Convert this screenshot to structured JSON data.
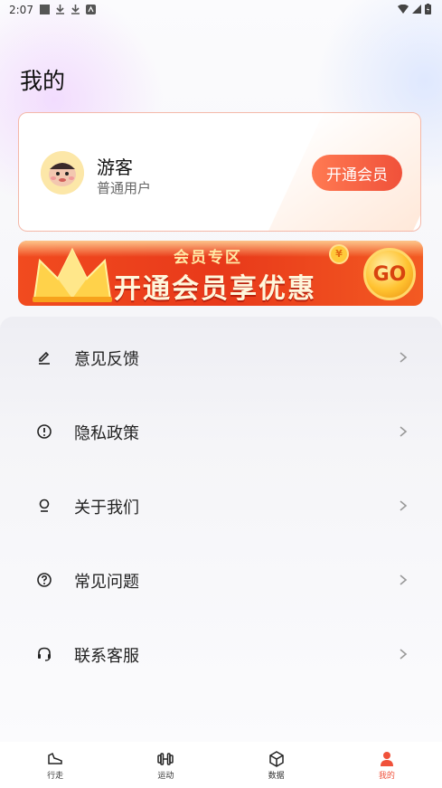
{
  "status_bar": {
    "time": "2:07"
  },
  "page": {
    "title": "我的"
  },
  "profile": {
    "name": "游客",
    "level": "普通用户",
    "vip_button": "开通会员"
  },
  "banner": {
    "subtitle": "会员专区",
    "headline": "开通会员享优惠",
    "go_label": "GO",
    "coin_label": "¥"
  },
  "menu": [
    {
      "label": "意见反馈",
      "icon": "edit-icon"
    },
    {
      "label": "隐私政策",
      "icon": "privacy-icon"
    },
    {
      "label": "关于我们",
      "icon": "about-icon"
    },
    {
      "label": "常见问题",
      "icon": "question-icon"
    },
    {
      "label": "联系客服",
      "icon": "headset-icon"
    }
  ],
  "tabs": [
    {
      "label": "行走",
      "icon": "shoe-icon",
      "active": false
    },
    {
      "label": "运动",
      "icon": "dumbbell-icon",
      "active": false
    },
    {
      "label": "数据",
      "icon": "cube-icon",
      "active": false
    },
    {
      "label": "我的",
      "icon": "user-icon",
      "active": true
    }
  ],
  "colors": {
    "accent": "#f0513a",
    "card_border": "#f4b8a8"
  }
}
